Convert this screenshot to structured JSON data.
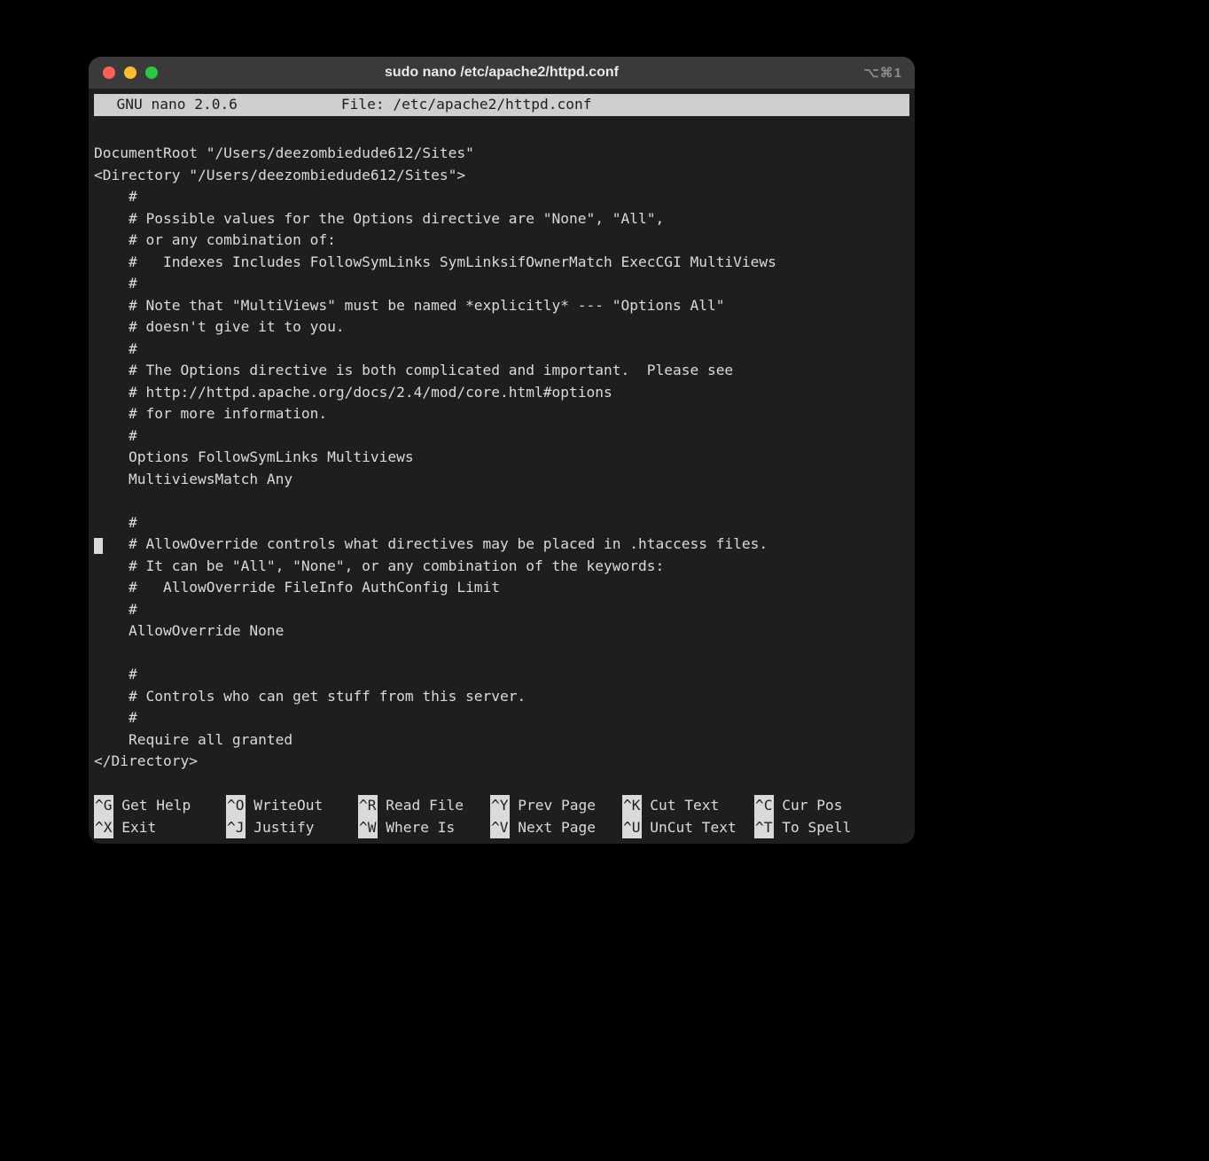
{
  "window": {
    "title": "sudo nano /etc/apache2/httpd.conf",
    "shortcut": "⌥⌘1"
  },
  "nano": {
    "status_left": "  GNU nano 2.0.6",
    "status_center": "File: /etc/apache2/httpd.conf",
    "cursor_line_index": 19,
    "lines": [
      "",
      "DocumentRoot \"/Users/deezombiedude612/Sites\"",
      "<Directory \"/Users/deezombiedude612/Sites\">",
      "    #",
      "    # Possible values for the Options directive are \"None\", \"All\",",
      "    # or any combination of:",
      "    #   Indexes Includes FollowSymLinks SymLinksifOwnerMatch ExecCGI MultiViews",
      "    #",
      "    # Note that \"MultiViews\" must be named *explicitly* --- \"Options All\"",
      "    # doesn't give it to you.",
      "    #",
      "    # The Options directive is both complicated and important.  Please see",
      "    # http://httpd.apache.org/docs/2.4/mod/core.html#options",
      "    # for more information.",
      "    #",
      "    Options FollowSymLinks Multiviews",
      "    MultiviewsMatch Any",
      "",
      "    #",
      "    # AllowOverride controls what directives may be placed in .htaccess files.",
      "    # It can be \"All\", \"None\", or any combination of the keywords:",
      "    #   AllowOverride FileInfo AuthConfig Limit",
      "    #",
      "    AllowOverride None",
      "",
      "    #",
      "    # Controls who can get stuff from this server.",
      "    #",
      "    Require all granted",
      "</Directory>",
      ""
    ],
    "menu": [
      [
        {
          "key": "^G",
          "label": "Get Help"
        },
        {
          "key": "^O",
          "label": "WriteOut"
        },
        {
          "key": "^R",
          "label": "Read File"
        },
        {
          "key": "^Y",
          "label": "Prev Page"
        },
        {
          "key": "^K",
          "label": "Cut Text"
        },
        {
          "key": "^C",
          "label": "Cur Pos"
        }
      ],
      [
        {
          "key": "^X",
          "label": "Exit"
        },
        {
          "key": "^J",
          "label": "Justify"
        },
        {
          "key": "^W",
          "label": "Where Is"
        },
        {
          "key": "^V",
          "label": "Next Page"
        },
        {
          "key": "^U",
          "label": "UnCut Text"
        },
        {
          "key": "^T",
          "label": "To Spell"
        }
      ]
    ]
  }
}
